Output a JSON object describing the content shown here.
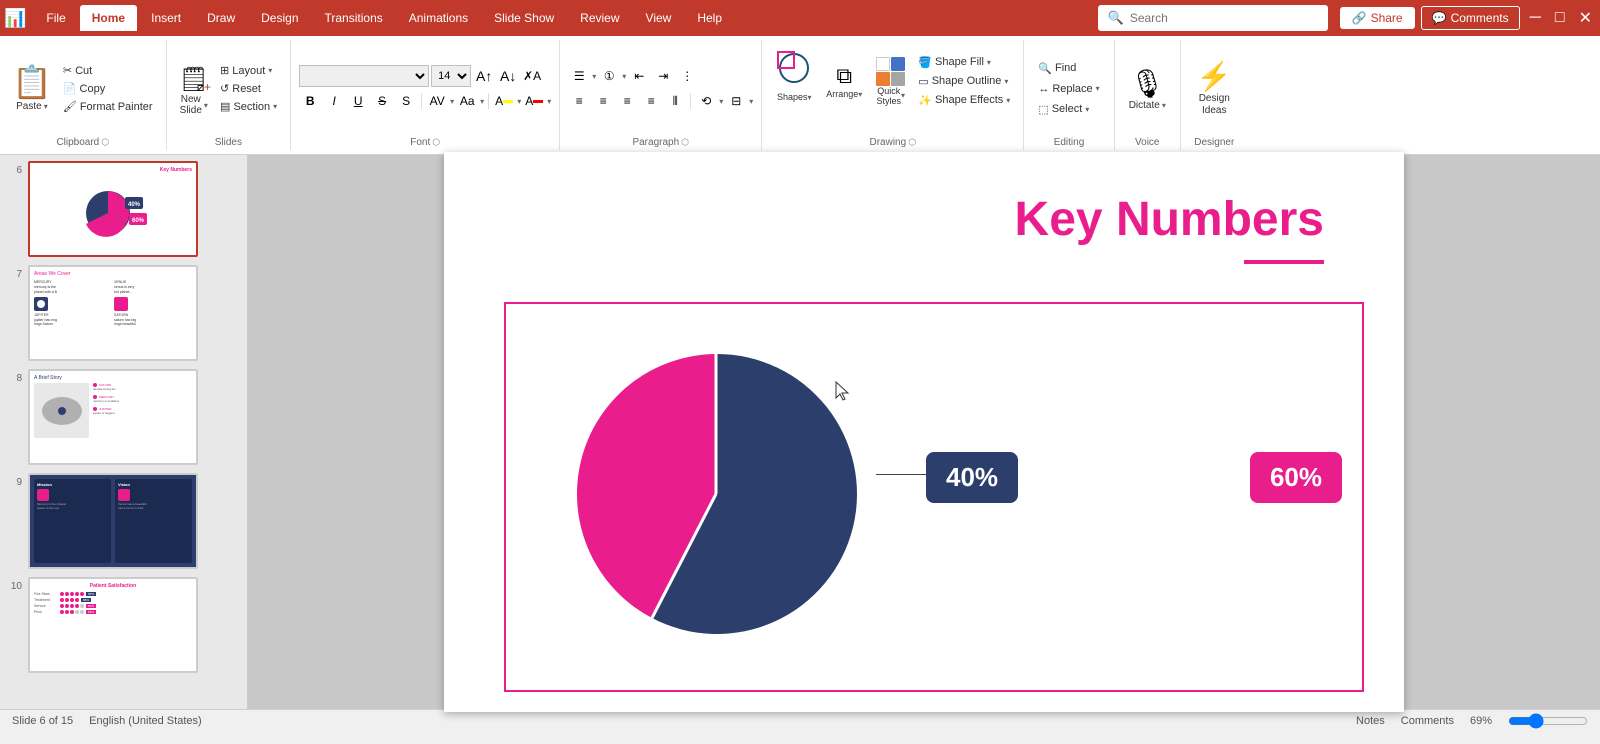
{
  "app": {
    "title": "PowerPoint",
    "file_icon": "📊"
  },
  "titlebar": {
    "tabs": [
      {
        "label": "File",
        "active": false
      },
      {
        "label": "Home",
        "active": true
      },
      {
        "label": "Insert",
        "active": false
      },
      {
        "label": "Draw",
        "active": false
      },
      {
        "label": "Design",
        "active": false
      },
      {
        "label": "Transitions",
        "active": false
      },
      {
        "label": "Animations",
        "active": false
      },
      {
        "label": "Slide Show",
        "active": false
      },
      {
        "label": "Review",
        "active": false
      },
      {
        "label": "View",
        "active": false
      },
      {
        "label": "Help",
        "active": false
      }
    ],
    "search_placeholder": "Search",
    "share_label": "Share",
    "comments_label": "Comments"
  },
  "ribbon": {
    "groups": {
      "clipboard": {
        "label": "Clipboard",
        "paste_label": "Paste",
        "cut_label": "Cut",
        "copy_label": "Copy",
        "format_painter_label": "Format Painter"
      },
      "slides": {
        "label": "Slides",
        "new_slide_label": "New\nSlide",
        "layout_label": "Layout",
        "reset_label": "Reset",
        "section_label": "Section"
      },
      "font": {
        "label": "Font",
        "font_value": "",
        "size_value": "14",
        "bold": "B",
        "italic": "I",
        "underline": "U",
        "strikethrough": "S",
        "shadow": "s",
        "expand_label": "↗"
      },
      "paragraph": {
        "label": "Paragraph"
      },
      "drawing": {
        "label": "Drawing",
        "shapes_label": "Shapes",
        "arrange_label": "Arrange",
        "quick_styles_label": "Quick\nStyles",
        "shape_fill_label": "Shape Fill",
        "shape_outline_label": "Shape Outline",
        "shape_effects_label": "Shape Effects"
      },
      "editing": {
        "label": "Editing",
        "find_label": "Find",
        "replace_label": "Replace",
        "select_label": "Select"
      },
      "voice": {
        "label": "Voice",
        "dictate_label": "Dictate"
      },
      "designer": {
        "label": "Designer",
        "design_ideas_label": "Design\nIdeas"
      }
    }
  },
  "slides": [
    {
      "number": "6",
      "title": "Key Numbers",
      "selected": true,
      "bg": "white",
      "type": "keynumbers"
    },
    {
      "number": "7",
      "title": "Areas We Cover",
      "selected": false,
      "bg": "white",
      "type": "areas"
    },
    {
      "number": "8",
      "title": "A Brief Story",
      "selected": false,
      "bg": "white",
      "type": "story"
    },
    {
      "number": "9",
      "title": "Mission/Vision",
      "selected": false,
      "bg": "dark",
      "type": "mission"
    },
    {
      "number": "10",
      "title": "Patient Satisfaction",
      "selected": false,
      "bg": "white",
      "type": "satisfaction"
    }
  ],
  "current_slide": {
    "title": "Key Numbers",
    "percent_40": "40%",
    "percent_60": "60%",
    "color_pink": "#e91e8c",
    "color_dark": "#2c3e6b"
  },
  "status_bar": {
    "slide_info": "Slide 6 of 15",
    "language": "English (United States)",
    "notes": "Notes",
    "comments": "Comments",
    "zoom": "69%"
  }
}
